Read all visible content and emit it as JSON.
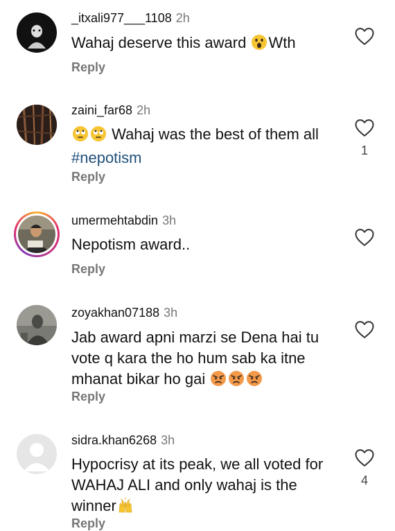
{
  "reply_label": "Reply",
  "comments": [
    {
      "username": "_itxali977___1108",
      "time": "2h",
      "text_parts": [
        "Wahaj deserve this award ",
        "surprised-face-emoji",
        "Wth"
      ],
      "text_main": "Wahaj deserve this award",
      "text_tail": "Wth",
      "emoji": "surprised-face",
      "likes": ""
    },
    {
      "username": "zaini_far68",
      "time": "2h",
      "text_emojis": [
        "rolling-eyes",
        "rolling-eyes"
      ],
      "text_main": "Wahaj was the best of them all",
      "hashtag": "#nepotism",
      "likes": "1"
    },
    {
      "username": "umermehtabdin",
      "time": "3h",
      "text_main": "Nepotism award..",
      "likes": ""
    },
    {
      "username": "zoyakhan07188",
      "time": "3h",
      "text_line1": "Jab award apni marzi se Dena hai tu",
      "text_line2": "vote q kara the ho hum sab ka itne",
      "text_line3": "mhanat bikar ho gai",
      "text_emojis": [
        "angry-face",
        "angry-face",
        "angry-face"
      ],
      "likes": ""
    },
    {
      "username": "sidra.khan6268",
      "time": "3h",
      "text_line1": "Hypocrisy at its peak, we all voted for",
      "text_line2": "WAHAJ ALI and only wahaj is the",
      "text_line3": "winner",
      "text_emojis": [
        "raising-hands"
      ],
      "likes": "4"
    }
  ],
  "colors": {
    "text": "#111111",
    "secondary": "#777777",
    "hashtag": "#1f4f7a",
    "emoji_yellow": "#f7c531",
    "emoji_angry": "#f2994a"
  }
}
